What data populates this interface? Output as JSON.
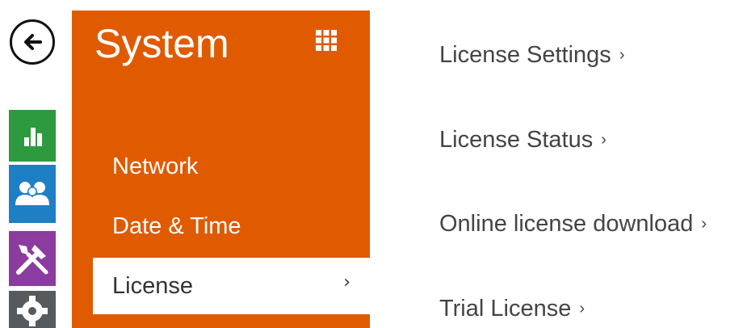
{
  "colors": {
    "panel": "#e05a00",
    "status_tile": "#2d9a3f",
    "directory_tile": "#1f7fc4",
    "hardware_tile": "#8b3c9e",
    "system_tile": "#555a5f",
    "text": "#444444"
  },
  "sidebar": {
    "icons": [
      "back-arrow-icon",
      "bar-chart-icon",
      "users-icon",
      "tools-icon",
      "gear-icon"
    ]
  },
  "panel": {
    "title": "System",
    "menu_icon": "grid-icon",
    "items": [
      {
        "label": "Network",
        "active": false
      },
      {
        "label": "Date & Time",
        "active": false
      },
      {
        "label": "License",
        "active": true,
        "chevron": "›"
      }
    ]
  },
  "main": {
    "links": [
      {
        "label": "License Settings",
        "chevron": "›"
      },
      {
        "label": "License Status",
        "chevron": "›"
      },
      {
        "label": "Online license download",
        "chevron": "›"
      },
      {
        "label": "Trial License",
        "chevron": "›"
      }
    ]
  }
}
